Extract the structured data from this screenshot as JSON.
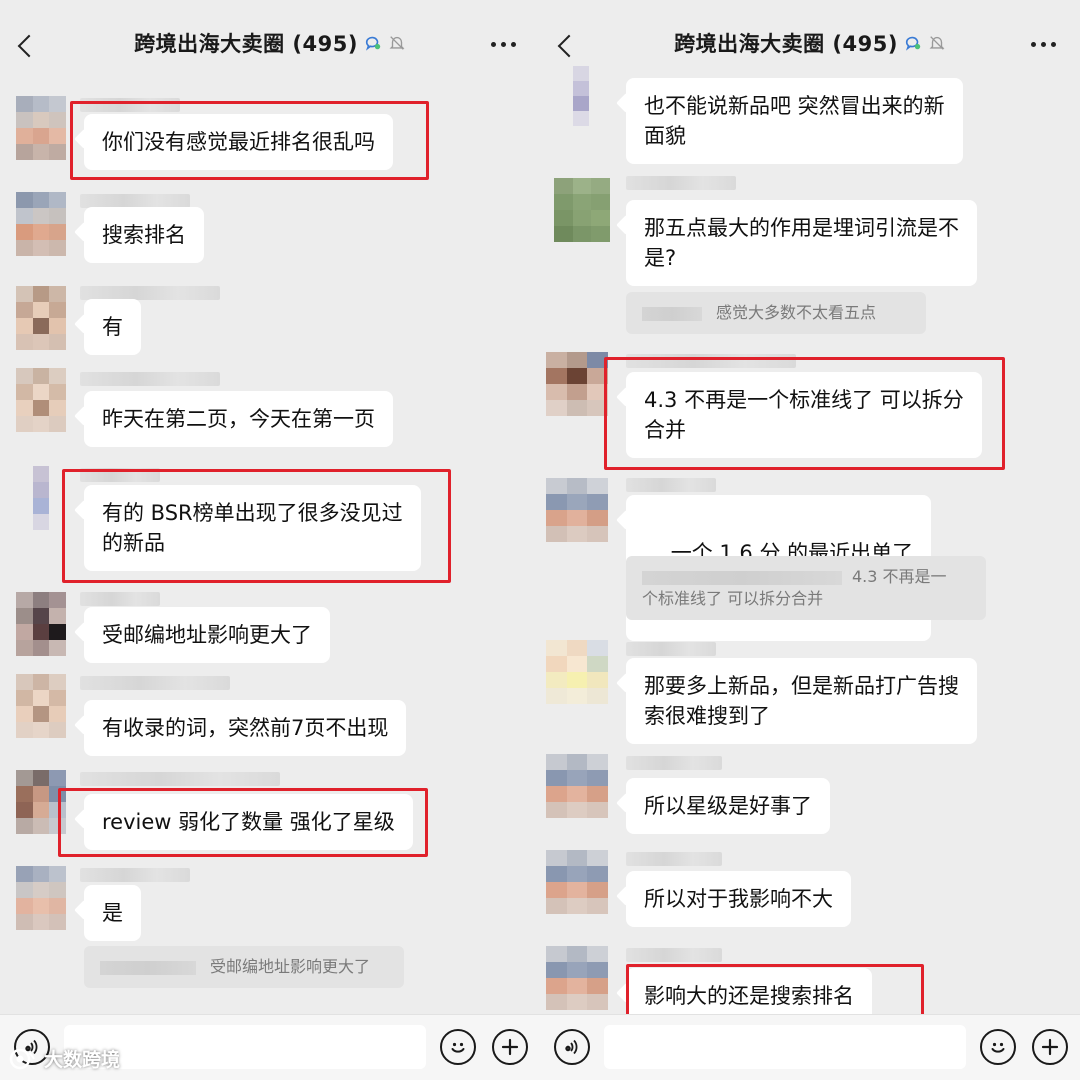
{
  "colors": {
    "highlight": "#e0212b",
    "bubble": "#ffffff",
    "background": "#ededed"
  },
  "left": {
    "header": {
      "title": "跨境出海大卖圈 (495)"
    },
    "messages": [
      {
        "text": "你们没有感觉最近排名很乱吗"
      },
      {
        "text": "搜索排名"
      },
      {
        "text": "有"
      },
      {
        "text": "昨天在第二页，今天在第一页"
      },
      {
        "text": "有的 BSR榜单出现了很多没见过\n的新品"
      },
      {
        "text": "受邮编地址影响更大了"
      },
      {
        "text": "有收录的词，突然前7页不出现"
      },
      {
        "text": "review 弱化了数量 强化了星级"
      },
      {
        "text": "是"
      }
    ],
    "quote": {
      "text": "受邮编地址影响更大了"
    }
  },
  "right": {
    "header": {
      "title": "跨境出海大卖圈 (495)"
    },
    "messages": [
      {
        "text": "也不能说新品吧 突然冒出来的新\n面貌"
      },
      {
        "text": "那五点最大的作用是埋词引流是不\n是?"
      },
      {
        "text": "4.3 不再是一个标准线了 可以拆分\n合并"
      },
      {
        "text": "一个 1.6 分 的最近出单了"
      },
      {
        "text": "那要多上新品，但是新品打广告搜\n索很难搜到了"
      },
      {
        "text": "所以星级是好事了"
      },
      {
        "text": "所以对于我影响不大"
      },
      {
        "text": "影响大的还是搜索排名"
      }
    ],
    "quote1": {
      "text": "感觉大多数不太看五点"
    },
    "quote2": {
      "text_line1": "4.3 不再是一",
      "text_line2": "个标准线了 可以拆分合并"
    }
  },
  "watermark": {
    "text": "大数跨境"
  }
}
